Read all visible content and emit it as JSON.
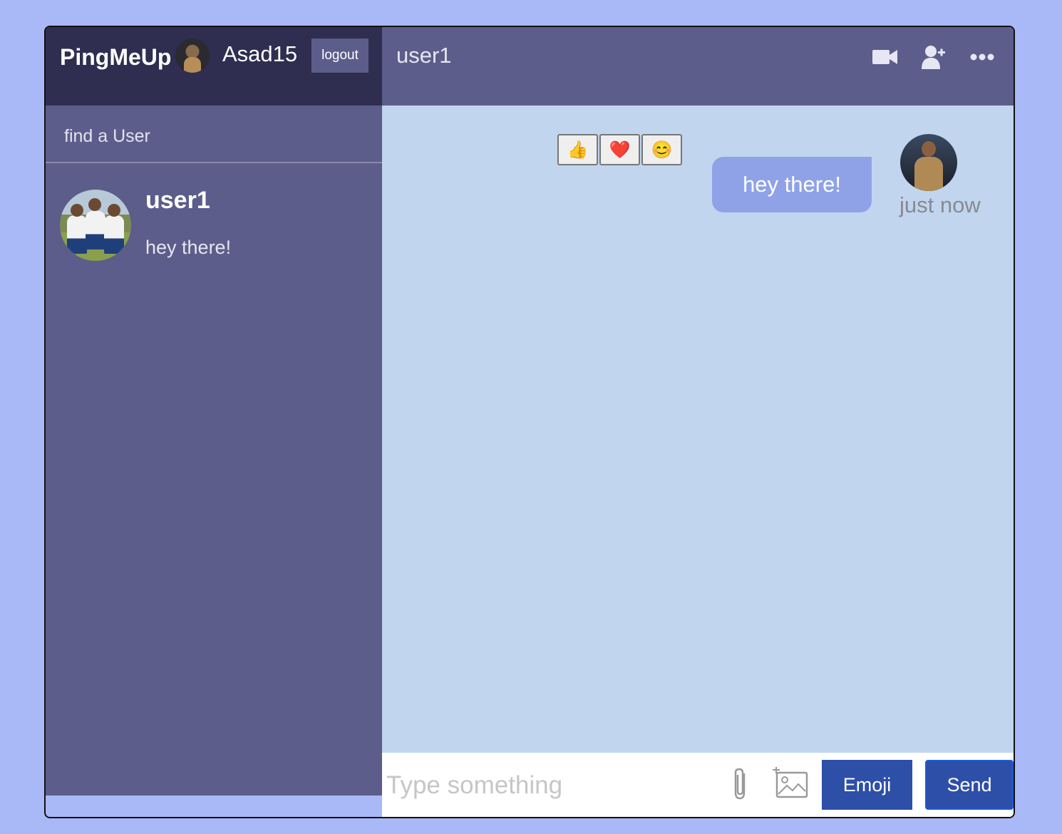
{
  "navbar": {
    "logo": "PingMeUp",
    "username": "Asad15",
    "logout_label": "logout"
  },
  "search": {
    "placeholder": "find a User"
  },
  "chats": [
    {
      "name": "user1",
      "last_message": "hey there!"
    }
  ],
  "chat_header": {
    "title": "user1",
    "icons": [
      "video-camera-icon",
      "add-user-icon",
      "more-icon"
    ]
  },
  "messages": [
    {
      "text": "hey there!",
      "time": "just now",
      "reactions": [
        "👍",
        "❤️",
        "😊"
      ]
    }
  ],
  "input": {
    "placeholder": "Type something",
    "emoji_label": "Emoji",
    "send_label": "Send"
  },
  "colors": {
    "background": "#a9b9f7",
    "sidebar": "#5c5d8a",
    "navbar": "#2f2e50",
    "chat_bg": "#c1d5ee",
    "bubble": "#8fa2e8",
    "button": "#2d4fa8"
  }
}
